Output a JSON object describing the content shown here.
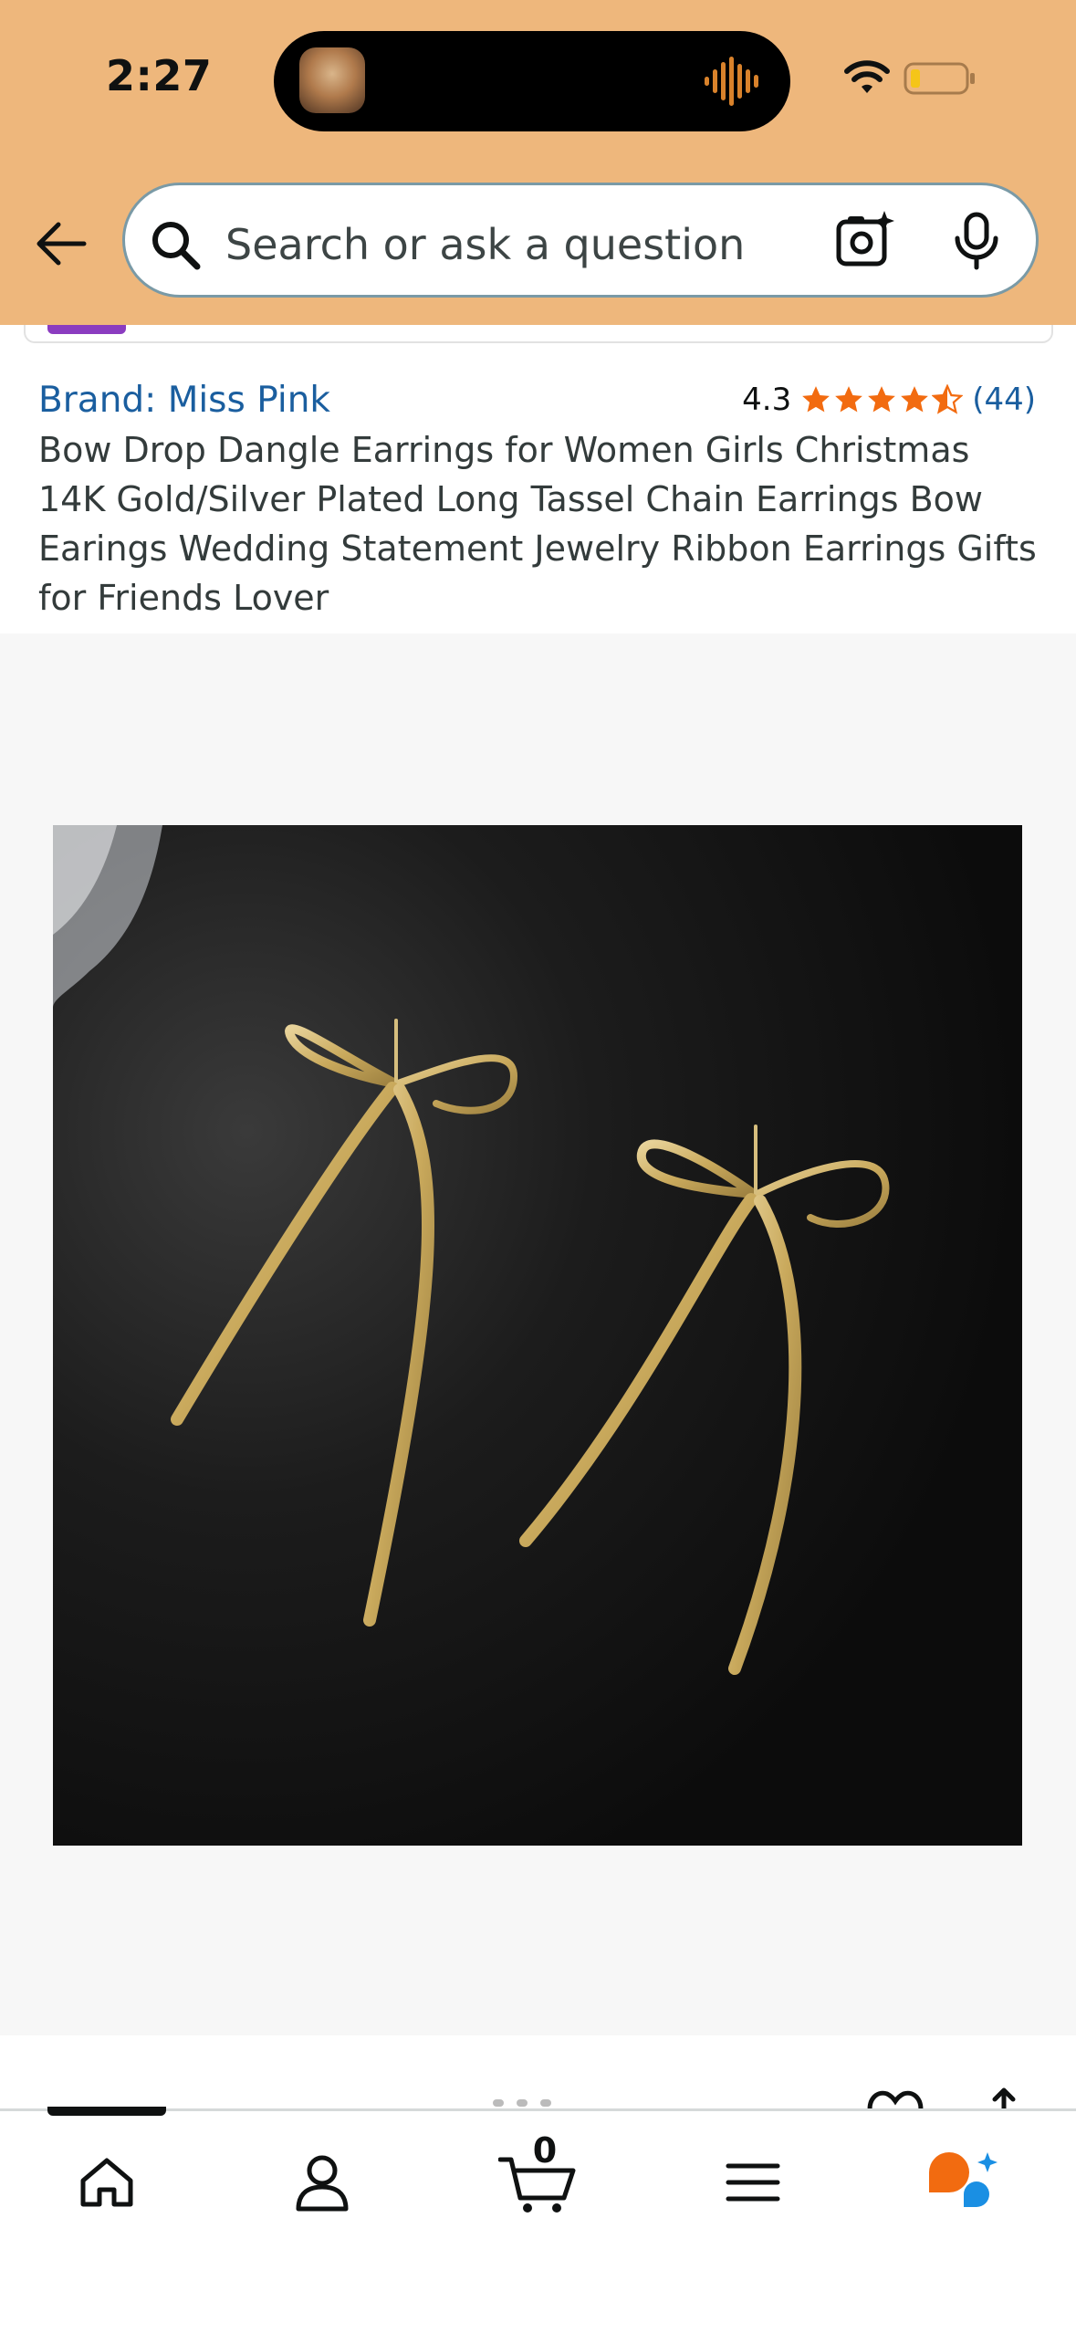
{
  "status_bar": {
    "time": "2:27"
  },
  "search": {
    "placeholder": "Search or ask a question"
  },
  "product": {
    "brand": "Brand: Miss Pink",
    "rating": "4.3",
    "star_rating": 4.3,
    "review_count": "(44)",
    "title": "Bow Drop Dangle Earrings for Women Girls Christmas 14K Gold/Silver Plated Long Tassel Chain Earrings Bow Earings Wedding Statement Jewelry Ribbon Earrings Gifts for Friends Lover"
  },
  "bottom_nav": {
    "items": [
      "home-icon",
      "account-icon",
      "cart-icon",
      "menu-icon",
      "rufus-icon"
    ],
    "cart_count": "0"
  },
  "colors": {
    "header_bg": "#eeb77c",
    "link": "#1a5e9f",
    "star": "#f26b10"
  }
}
